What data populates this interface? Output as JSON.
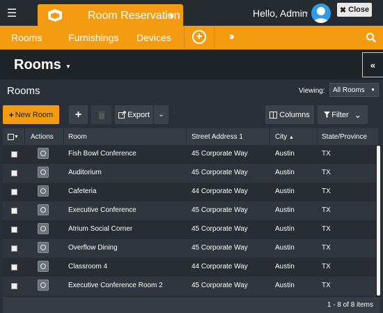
{
  "header": {
    "app_title": "Room Reservation",
    "greeting": "Hello, Admin",
    "close_label": "Close"
  },
  "nav": {
    "items": [
      "Rooms",
      "Furnishings",
      "Devices"
    ]
  },
  "page": {
    "title": "Rooms",
    "section_title": "Rooms",
    "viewing_label": "Viewing:",
    "viewing_value": "All Rooms"
  },
  "toolbar": {
    "new_room_label": "New Room",
    "export_label": "Export",
    "columns_label": "Columns",
    "filter_label": "Filter"
  },
  "table": {
    "columns": [
      "Actions",
      "Room",
      "Street Address 1",
      "City",
      "State/Province"
    ],
    "rows": [
      {
        "room": "Fish Bowl Conference",
        "address": "45 Corporate Way",
        "city": "Austin",
        "state": "TX"
      },
      {
        "room": "Auditorium",
        "address": "45 Corporate Way",
        "city": "Austin",
        "state": "TX"
      },
      {
        "room": "Cafeteria",
        "address": "44 Corporate Way",
        "city": "Austin",
        "state": "TX"
      },
      {
        "room": "Executive Conference",
        "address": "45 Corporate Way",
        "city": "Austin",
        "state": "TX"
      },
      {
        "room": "Atrium Social Corner",
        "address": "45 Corporate Way",
        "city": "Austin",
        "state": "TX"
      },
      {
        "room": "Overflow Dining",
        "address": "45 Corporate Way",
        "city": "Austin",
        "state": "TX"
      },
      {
        "room": "Classroom 4",
        "address": "44 Corporate Way",
        "city": "Austin",
        "state": "TX"
      },
      {
        "room": "Executive Conference Room 2",
        "address": "45 Corporate Way",
        "city": "Austin",
        "state": "TX"
      }
    ],
    "pager_text": "1 - 8 of 8 items"
  },
  "colors": {
    "accent": "#f39c12",
    "header_bg": "#262b30",
    "panel_bg": "#2a3037"
  }
}
